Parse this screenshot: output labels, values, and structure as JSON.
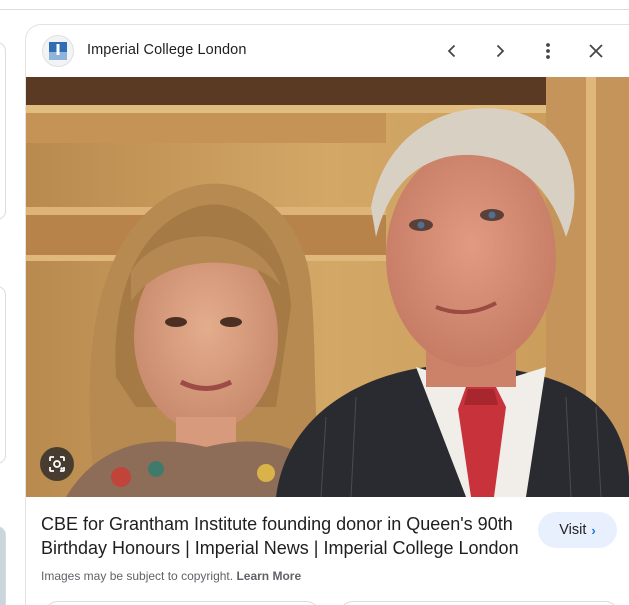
{
  "header": {
    "source_name": "Imperial College London",
    "logo_icon": "imperial-college-logo",
    "actions": [
      "chevron-left-icon",
      "chevron-right-icon",
      "more-vert-icon",
      "close-icon"
    ]
  },
  "image": {
    "description_icon": "photo",
    "lens_icon": "google-lens-icon"
  },
  "result": {
    "title": "CBE for Grantham Institute founding donor in Queen's 90th Birthday Honours | Imperial News | Imperial College London",
    "visit_label": "Visit",
    "visit_icon": "chevron-right-icon"
  },
  "footer": {
    "copyright_text": "Images may be subject to copyright.",
    "learn_more_label": "Learn More"
  },
  "colors": {
    "accent": "#1a73e8",
    "visit_bg": "#e8f0fe",
    "logo_blue": "#1f5fa8"
  }
}
